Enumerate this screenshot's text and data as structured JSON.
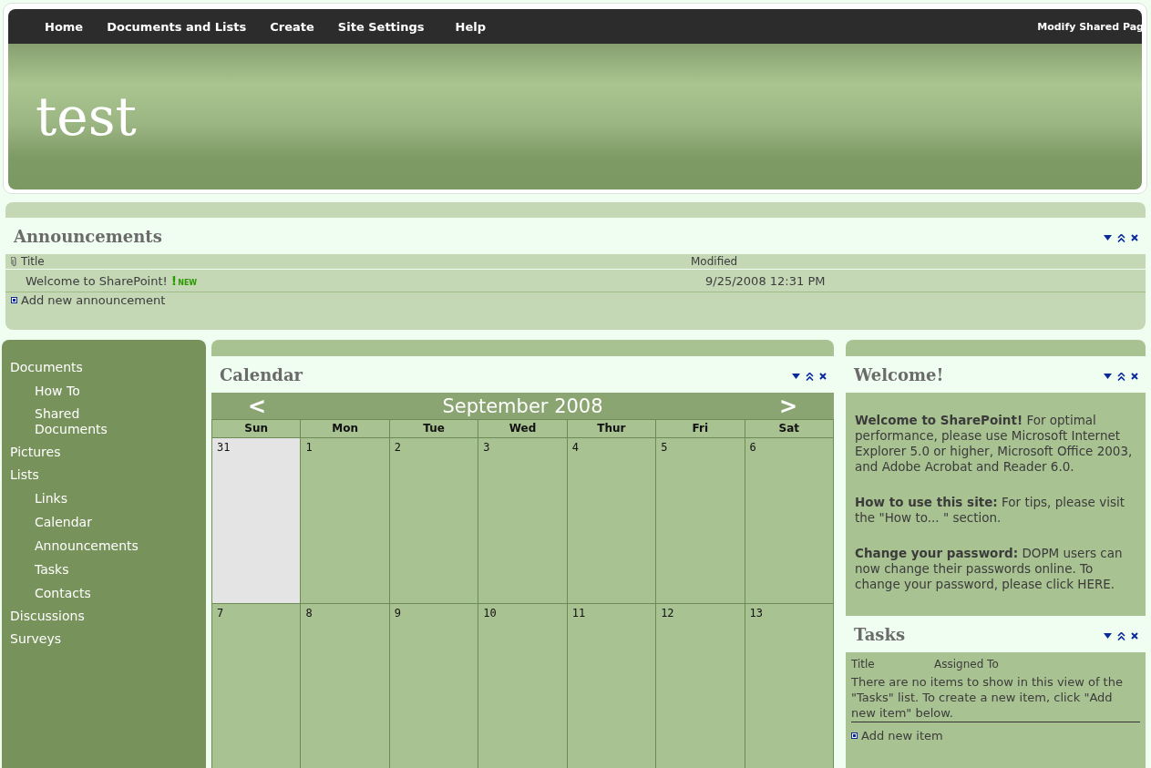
{
  "top_nav": {
    "items": [
      {
        "label": "Home"
      },
      {
        "label": "Documents and Lists"
      },
      {
        "label": "Create"
      },
      {
        "label": "Site Settings"
      },
      {
        "label": "Help"
      }
    ],
    "right_link": "Modify Shared Pag"
  },
  "banner": {
    "title": "test"
  },
  "announcements": {
    "title": "Announcements",
    "columns": [
      "Title",
      "Modified"
    ],
    "rows": [
      {
        "title": "Welcome to SharePoint!",
        "is_new": true,
        "new_mark": "!",
        "new_label": "NEW",
        "modified": "9/25/2008 12:31 PM"
      }
    ],
    "add_link": "Add new announcement"
  },
  "sidebar": {
    "items": [
      {
        "label": "Documents",
        "children": [
          {
            "label": "How To"
          },
          {
            "label": "Shared Documents"
          }
        ]
      },
      {
        "label": "Pictures"
      },
      {
        "label": "Lists",
        "children": [
          {
            "label": "Links"
          },
          {
            "label": "Calendar"
          },
          {
            "label": "Announcements"
          },
          {
            "label": "Tasks"
          },
          {
            "label": "Contacts"
          }
        ]
      },
      {
        "label": "Discussions"
      },
      {
        "label": "Surveys"
      }
    ]
  },
  "calendar": {
    "title": "Calendar",
    "prev": "<",
    "next": ">",
    "month": "September 2008",
    "weekdays": [
      "Sun",
      "Mon",
      "Tue",
      "Wed",
      "Thur",
      "Fri",
      "Sat"
    ],
    "weeks": [
      [
        {
          "day": "31",
          "other_month": true
        },
        {
          "day": "1",
          "other_month": false
        },
        {
          "day": "2",
          "other_month": false
        },
        {
          "day": "3",
          "other_month": false
        },
        {
          "day": "4",
          "other_month": false
        },
        {
          "day": "5",
          "other_month": false
        },
        {
          "day": "6",
          "other_month": false
        }
      ],
      [
        {
          "day": "7",
          "other_month": false
        },
        {
          "day": "8",
          "other_month": false
        },
        {
          "day": "9",
          "other_month": false
        },
        {
          "day": "10",
          "other_month": false
        },
        {
          "day": "11",
          "other_month": false
        },
        {
          "day": "12",
          "other_month": false
        },
        {
          "day": "13",
          "other_month": false
        }
      ]
    ]
  },
  "welcome": {
    "title": "Welcome!",
    "paragraphs": [
      "**Welcome to SharePoint!** For optimal performance, please use Microsoft Internet Explorer 5.0 or higher, Microsoft Office 2003, and Adobe Acrobat and Reader 6.0.",
      "**How to use this site:** For tips, please visit the \"How to... \" section.",
      "**Change your password:** DOPM users can now change their passwords online. To change your password, please click HERE."
    ]
  },
  "tasks": {
    "title": "Tasks",
    "columns": [
      "Title",
      "Assigned To"
    ],
    "empty_message": "There are no items to show in this view of the \"Tasks\" list. To create a new item, click \"Add new item\" below.",
    "add_link": "Add new item"
  }
}
